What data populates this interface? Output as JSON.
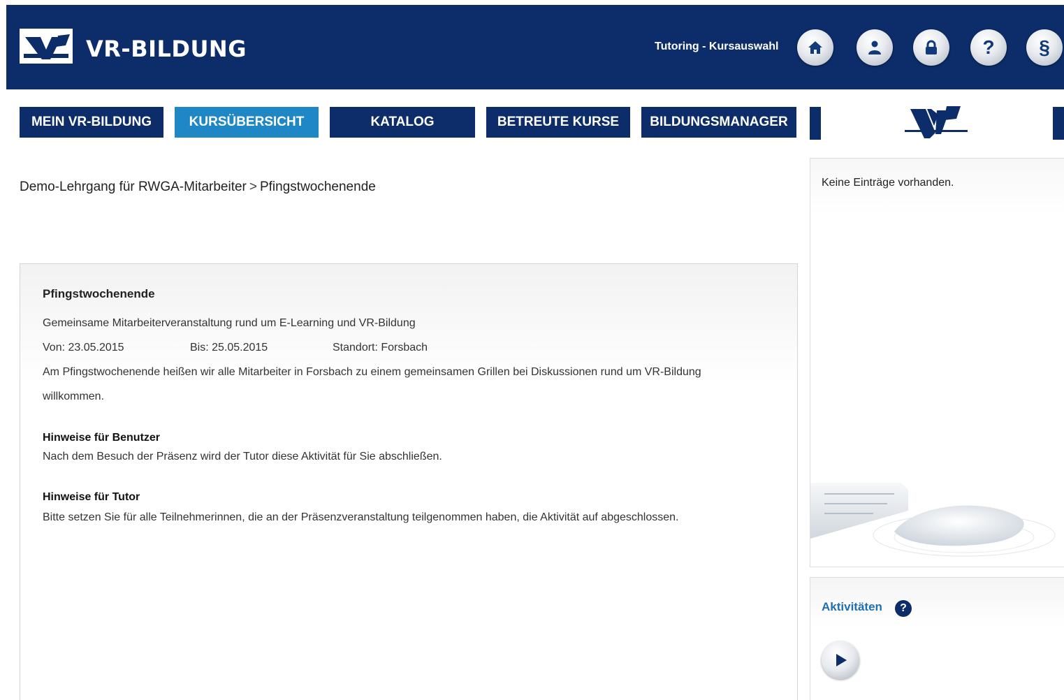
{
  "header": {
    "brand": "VR-BILDUNG",
    "title": "Tutoring - Kursauswahl",
    "icons": [
      "home-icon",
      "user-icon",
      "lock-icon",
      "help-icon",
      "paragraph-icon"
    ],
    "help_glyph": "?",
    "paragraph_glyph": "§"
  },
  "nav": {
    "items": [
      {
        "label": "MEIN VR-BILDUNG",
        "active": false
      },
      {
        "label": "KURSÜBERSICHT",
        "active": true
      },
      {
        "label": "KATALOG",
        "active": false
      },
      {
        "label": "BETREUTE KURSE",
        "active": false
      },
      {
        "label": "BILDUNGSMANAGER",
        "active": false
      }
    ]
  },
  "breadcrumb": {
    "items": [
      "Demo-Lehrgang für RWGA-Mitarbeiter",
      "Pfingstwochenende"
    ],
    "separator": ">"
  },
  "event": {
    "title": "Pfingstwochenende",
    "subtitle": "Gemeinsame Mitarbeiterveranstaltung rund um E-Learning und VR-Bildung",
    "from": "Von: 23.05.2015",
    "to": "Bis: 25.05.2015",
    "location": "Standort: Forsbach",
    "description_line1": "Am Pfingstwochenende heißen wir alle Mitarbeiter in Forsbach zu einem gemeinsamen Grillen bei Diskussionen rund um VR-Bildung",
    "description_line2": "willkommen.",
    "user_notes_heading": "Hinweise für Benutzer",
    "user_notes": "Nach dem Besuch der Präsenz wird der Tutor diese Aktivität für Sie abschließen.",
    "tutor_notes_heading": "Hinweise für Tutor",
    "tutor_notes": "Bitte setzen Sie für alle Teilnehmerinnen, die an der Präsenzveranstaltung teilgenommen haben, die Aktivität auf abgeschlossen."
  },
  "sidebar": {
    "entries_empty": "Keine Einträge vorhanden.",
    "activities_title": "Aktivitäten",
    "help_glyph": "?"
  },
  "colors": {
    "brand_navy": "#0c2d69",
    "active_tab": "#1f87c6",
    "link_blue": "#1f6fb5"
  }
}
